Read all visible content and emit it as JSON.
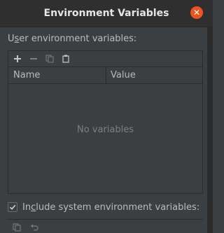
{
  "window": {
    "title": "Environment Variables"
  },
  "section": {
    "label_prefix": "U",
    "label_mnemonic": "s",
    "label_suffix": "er environment variables:"
  },
  "toolbar": {
    "icons": [
      "add-icon",
      "remove-icon",
      "copy-icon",
      "paste-icon"
    ]
  },
  "table": {
    "columns": [
      "Name",
      "Value"
    ],
    "empty_text": "No variables"
  },
  "include_system": {
    "checked": true,
    "label_prefix": "In",
    "label_mnemonic": "c",
    "label_suffix": "lude system environment variables:"
  },
  "bottom_toolbar": {
    "icons": [
      "copy-icon",
      "revert-icon"
    ]
  },
  "colors": {
    "background": "#3c3f41",
    "titlebar": "#2f2f2f",
    "close_button": "#e95420",
    "text": "#bbbbbb",
    "muted_text": "#7f7f7f"
  }
}
